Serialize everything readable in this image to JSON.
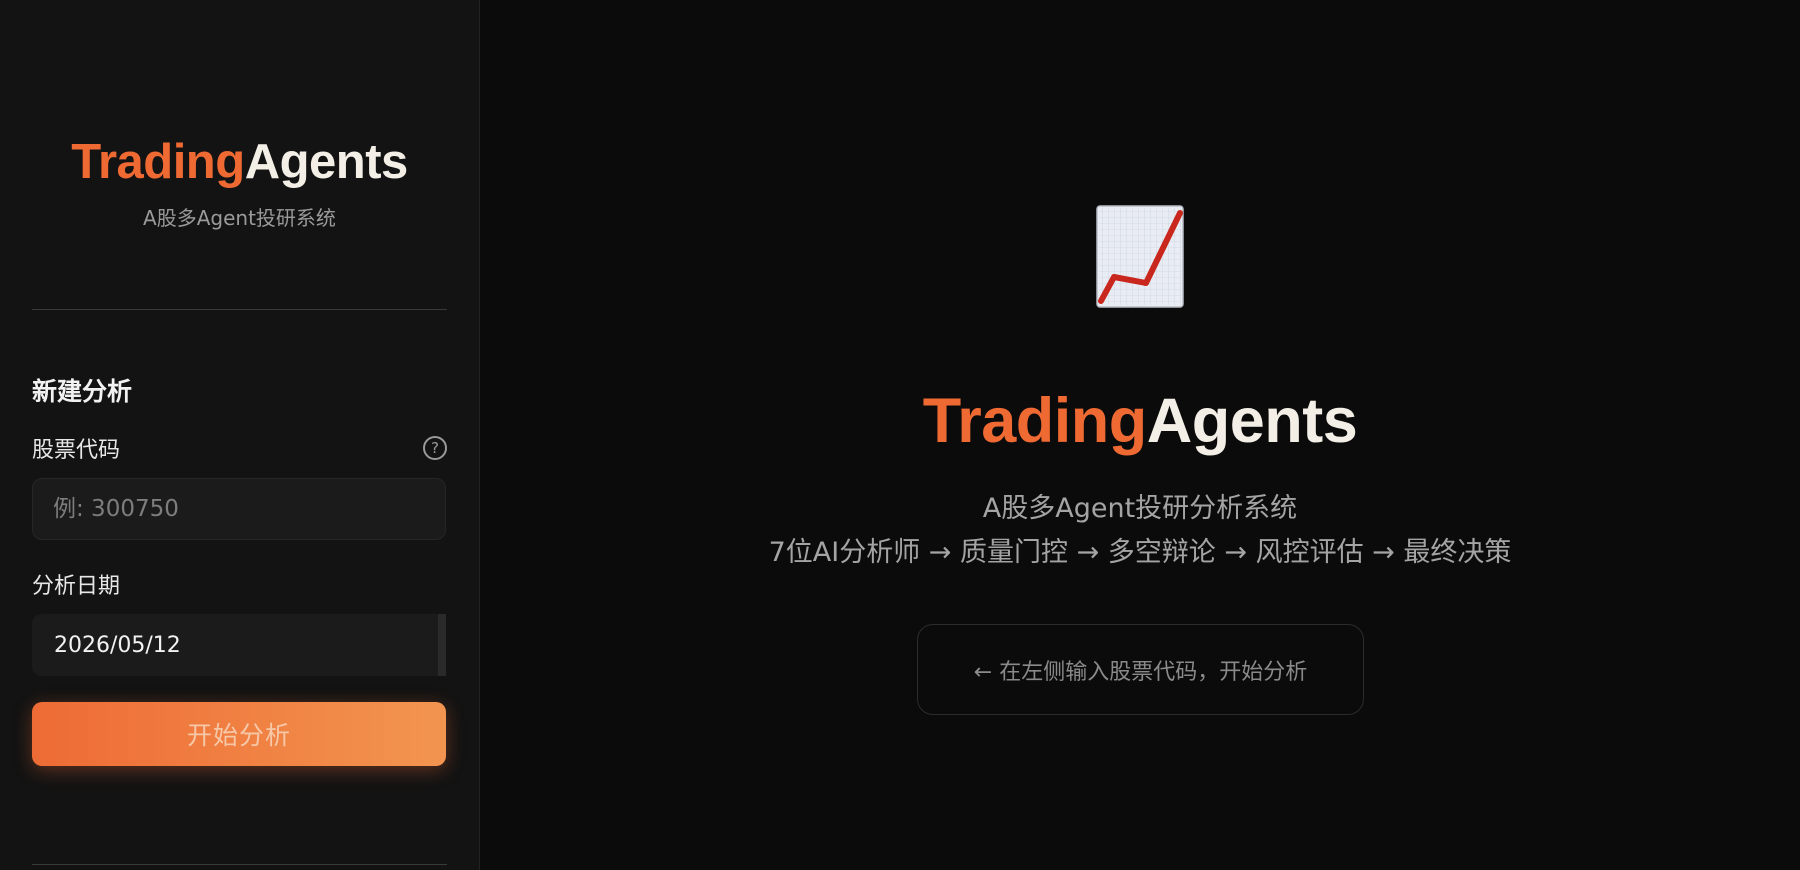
{
  "brand": {
    "part1": "Trading",
    "part2": "Agents",
    "subtitle": "A股多Agent投研系统"
  },
  "sidebar": {
    "section_title": "新建分析",
    "stock_code": {
      "label": "股票代码",
      "placeholder": "例: 300750",
      "value": "",
      "help_icon": "question-circle-icon"
    },
    "date": {
      "label": "分析日期",
      "value": "2026/05/12"
    },
    "start_button": "开始分析"
  },
  "main": {
    "icon": "chart-increasing-icon",
    "title_part1": "Trading",
    "title_part2": "Agents",
    "subtitle": "A股多Agent投研分析系统",
    "pipeline": "7位AI分析师 → 质量门控 → 多空辩论 → 风控评估 → 最终决策",
    "hint": "← 在左侧输入股票代码，开始分析"
  },
  "colors": {
    "accent": "#ef6a33",
    "accent_light": "#f29550",
    "background": "#0b0b0b",
    "sidebar": "#131313"
  }
}
